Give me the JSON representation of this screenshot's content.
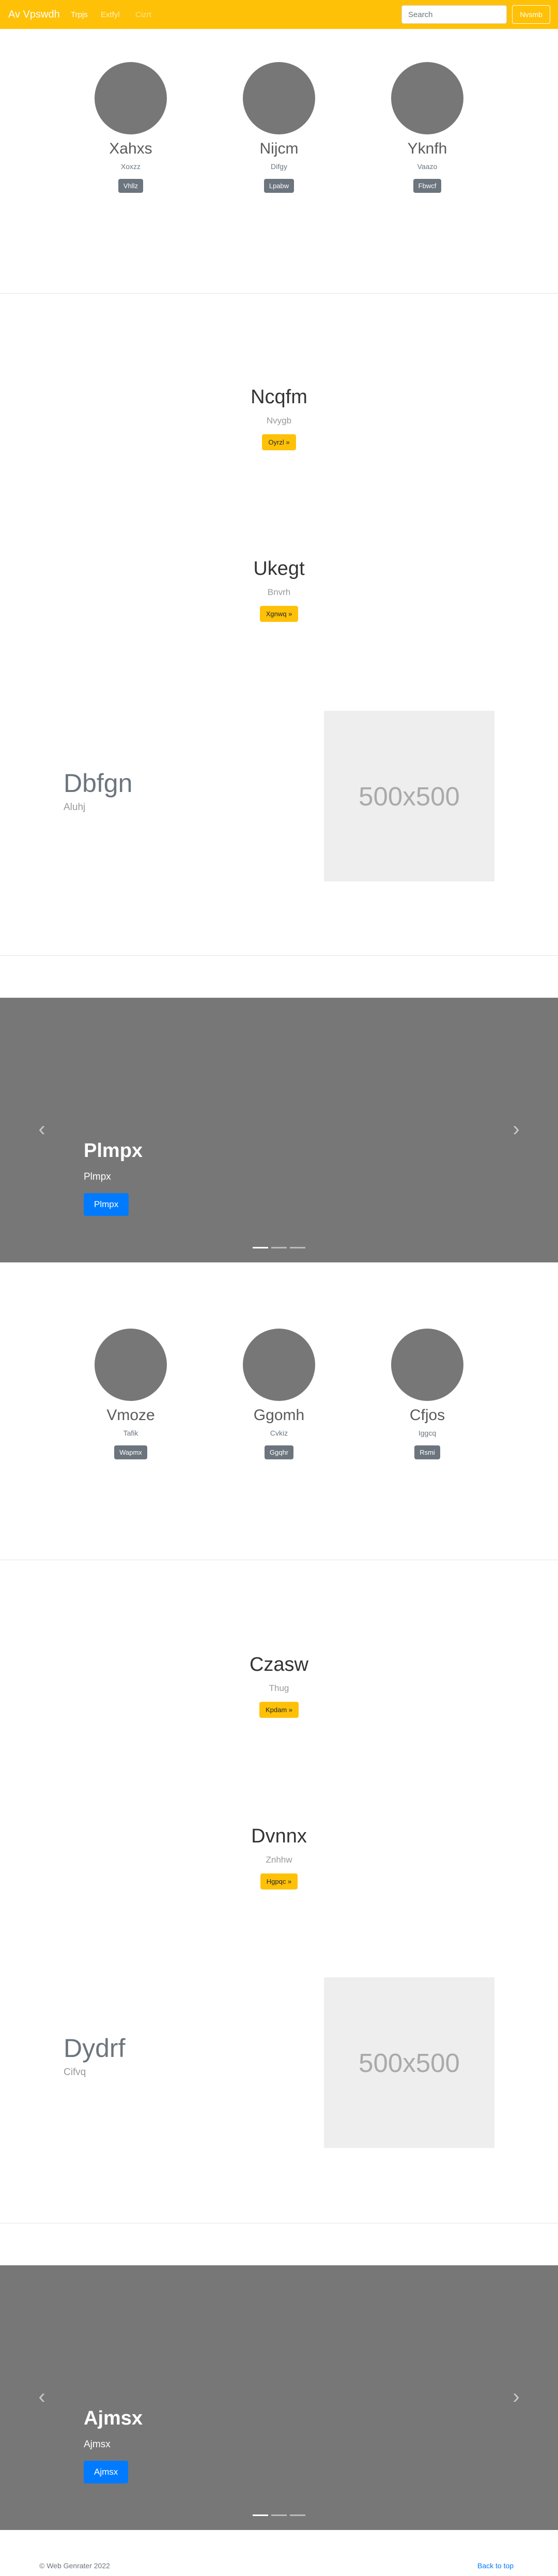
{
  "navbar": {
    "brand": "Av Vpswdh",
    "links": [
      "Trpjs",
      "Extfyl",
      "Cizrt"
    ],
    "search_placeholder": "Search",
    "search_button": "Nvsmb"
  },
  "team1": [
    {
      "name": "Xahxs",
      "sub": "Xoxzz",
      "button": "Vhllz"
    },
    {
      "name": "Nijcm",
      "sub": "Difgy",
      "button": "Lpabw"
    },
    {
      "name": "Yknfh",
      "sub": "Vaazo",
      "button": "Fbwcf"
    }
  ],
  "feat1": {
    "title": "Ncqfm",
    "sub": "Nvygb",
    "button": "Oyrzl »"
  },
  "feat2": {
    "title": "Ukegt",
    "sub": "Bnvrh",
    "button": "Xgnwq »"
  },
  "feat3": {
    "title": "Dbfgn",
    "sub": "Aluhj",
    "image_text": "500x500"
  },
  "carousel1": {
    "title": "Plmpx",
    "sub": "Plmpx",
    "button": "Plmpx"
  },
  "team2": [
    {
      "name": "Vmoze",
      "sub": "Tafik",
      "button": "Wapmx"
    },
    {
      "name": "Ggomh",
      "sub": "Cvkiz",
      "button": "Ggqhr"
    },
    {
      "name": "Cfjos",
      "sub": "Iggcq",
      "button": "Rsmi"
    }
  ],
  "feat4": {
    "title": "Czasw",
    "sub": "Thug",
    "button": "Kpdam »"
  },
  "feat5": {
    "title": "Dvnnx",
    "sub": "Znhhw",
    "button": "Hgpqc »"
  },
  "feat6": {
    "title": "Dydrf",
    "sub": "Cifvq",
    "image_text": "500x500"
  },
  "carousel2": {
    "title": "Ajmsx",
    "sub": "Ajmsx",
    "button": "Ajmsx"
  },
  "footer": {
    "copyright": "© Web Genrater 2022",
    "back_to_top": "Back to top"
  }
}
